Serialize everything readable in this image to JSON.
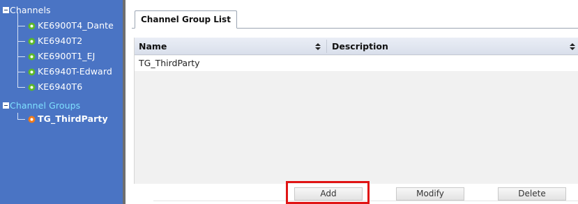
{
  "tree": {
    "channels_root": "Channels",
    "channels": [
      {
        "label": "KE6900T4_Dante"
      },
      {
        "label": "KE6940T2"
      },
      {
        "label": "KE6900T1_EJ"
      },
      {
        "label": "KE6940T-Edward"
      },
      {
        "label": "KE6940T6"
      }
    ],
    "groups_root": "Channel Groups",
    "groups": [
      {
        "label": "TG_ThirdParty"
      }
    ]
  },
  "tab": {
    "label": "Channel Group List"
  },
  "grid": {
    "columns": [
      {
        "label": "Name"
      },
      {
        "label": "Description"
      }
    ],
    "rows": [
      {
        "name": "TG_ThirdParty",
        "description": ""
      }
    ]
  },
  "buttons": {
    "add": "Add",
    "modify": "Modify",
    "delete": "Delete"
  },
  "colors": {
    "sidebar_bg": "#4a74c4",
    "channel_icon": "#5cb82a",
    "group_icon": "#f07a1a",
    "group_root_text": "#7fe0ff",
    "highlight": "#e01414"
  }
}
